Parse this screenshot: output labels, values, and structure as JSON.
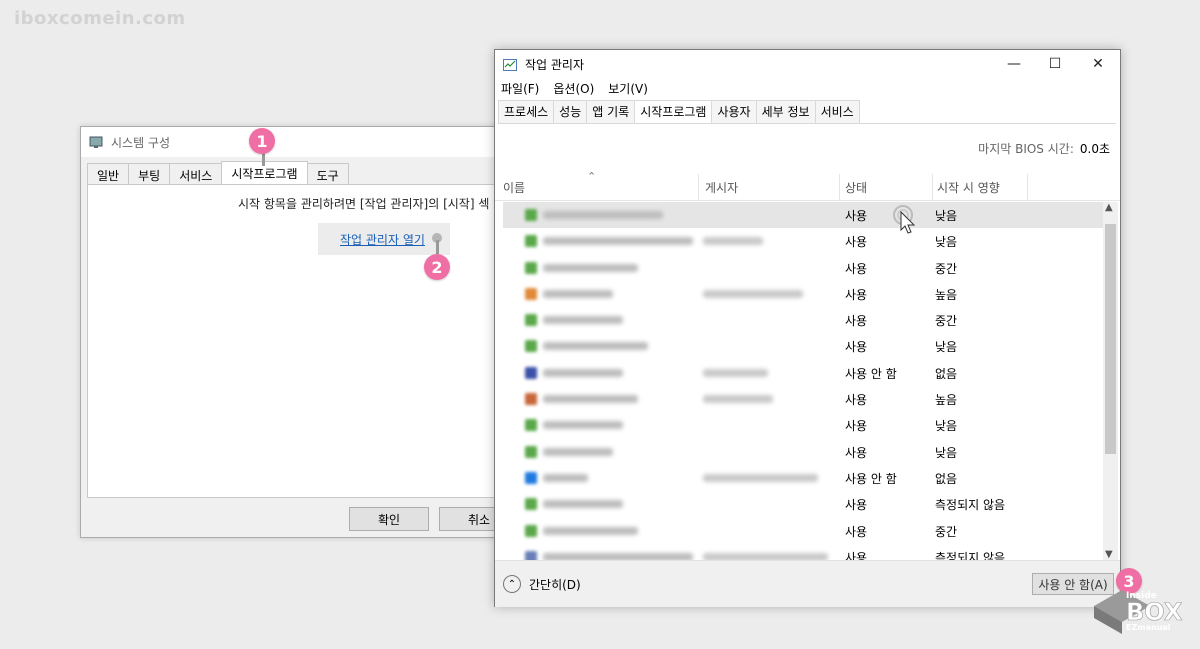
{
  "site_logo": "iboxcomein.com",
  "msconfig": {
    "title": "시스템 구성",
    "tabs": [
      "일반",
      "부팅",
      "서비스",
      "시작프로그램",
      "도구"
    ],
    "description": "시작 항목을 관리하려면 [작업 관리자]의 [시작] 섹",
    "open_link": "작업 관리자 열기",
    "ok_label": "확인",
    "cancel_label": "취소"
  },
  "taskmgr": {
    "title": "작업 관리자",
    "menu": [
      "파일(F)",
      "옵션(O)",
      "보기(V)"
    ],
    "tabs": [
      "프로세스",
      "성능",
      "앱 기록",
      "시작프로그램",
      "사용자",
      "세부 정보",
      "서비스"
    ],
    "active_tab": "시작프로그램",
    "bios_label": "마지막 BIOS 시간:",
    "bios_value": "0.0초",
    "columns": {
      "name": "이름",
      "publisher": "게시자",
      "status": "상태",
      "impact": "시작 시 영향"
    },
    "rows": [
      {
        "status": "사용",
        "impact": "낮음",
        "icon_color": "#5aa84a",
        "name_w": 120,
        "pub_w": 0
      },
      {
        "status": "사용",
        "impact": "낮음",
        "icon_color": "#5aa84a",
        "name_w": 150,
        "pub_w": 60
      },
      {
        "status": "사용",
        "impact": "중간",
        "icon_color": "#5aa84a",
        "name_w": 95,
        "pub_w": 0
      },
      {
        "status": "사용",
        "impact": "높음",
        "icon_color": "#e08a3a",
        "name_w": 70,
        "pub_w": 100
      },
      {
        "status": "사용",
        "impact": "중간",
        "icon_color": "#5aa84a",
        "name_w": 80,
        "pub_w": 0
      },
      {
        "status": "사용",
        "impact": "낮음",
        "icon_color": "#5aa84a",
        "name_w": 105,
        "pub_w": 0
      },
      {
        "status": "사용 안 함",
        "impact": "없음",
        "icon_color": "#3a4fa8",
        "name_w": 80,
        "pub_w": 65
      },
      {
        "status": "사용",
        "impact": "높음",
        "icon_color": "#c8673a",
        "name_w": 95,
        "pub_w": 70
      },
      {
        "status": "사용",
        "impact": "낮음",
        "icon_color": "#5aa84a",
        "name_w": 80,
        "pub_w": 0
      },
      {
        "status": "사용",
        "impact": "낮음",
        "icon_color": "#5aa84a",
        "name_w": 70,
        "pub_w": 0
      },
      {
        "status": "사용 안 함",
        "impact": "없음",
        "icon_color": "#1f7ae0",
        "name_w": 45,
        "pub_w": 115
      },
      {
        "status": "사용",
        "impact": "측정되지 않음",
        "icon_color": "#5aa84a",
        "name_w": 80,
        "pub_w": 0
      },
      {
        "status": "사용",
        "impact": "중간",
        "icon_color": "#5aa84a",
        "name_w": 95,
        "pub_w": 0
      },
      {
        "status": "사용",
        "impact": "측정되지 않음",
        "icon_color": "#6a7fb8",
        "name_w": 150,
        "pub_w": 125
      }
    ],
    "less_details": "간단히(D)",
    "disable_button": "사용 안 함(A)"
  },
  "badges": [
    "1",
    "2",
    "3"
  ],
  "watermark": {
    "line1": "Inside",
    "line2": "BOX",
    "line3": "EZmanual"
  },
  "colors": {
    "badge": "#ef6fa4",
    "link": "#1a5fb4"
  }
}
